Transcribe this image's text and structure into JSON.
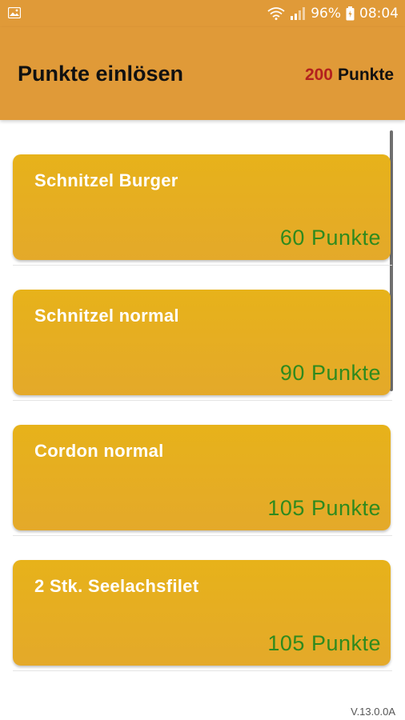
{
  "status_bar": {
    "battery": "96%",
    "time": "08:04",
    "icons": [
      "image-icon",
      "wifi-icon",
      "signal-icon",
      "battery-icon"
    ]
  },
  "header": {
    "title": "Punkte einlösen",
    "points_value": "200",
    "points_unit": "Punkte"
  },
  "rewards": [
    {
      "name": "Schnitzel Burger",
      "points": "60 Punkte"
    },
    {
      "name": "Schnitzel normal",
      "points": "90 Punkte"
    },
    {
      "name": "Cordon normal",
      "points": "105 Punkte"
    },
    {
      "name": "2 Stk. Seelachsfilet",
      "points": "105 Punkte"
    }
  ],
  "footer": {
    "version": "V.13.0.0A"
  },
  "colors": {
    "app_bar": "#e09a38",
    "card": "#e6ae20",
    "points_total": "#b3211e",
    "card_points": "#2f8a1e"
  }
}
